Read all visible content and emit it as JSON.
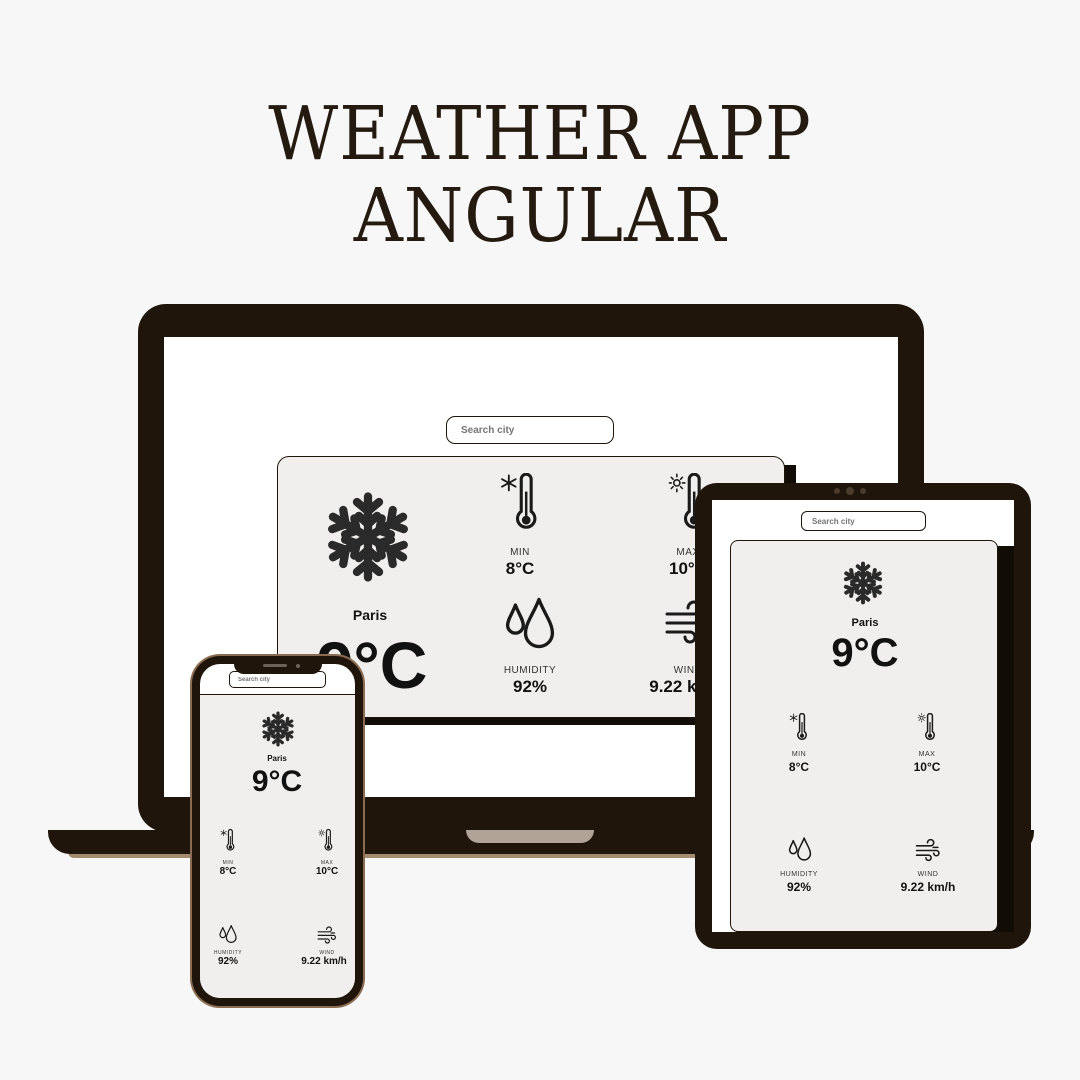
{
  "heading": {
    "line1": "WEATHER APP",
    "line2": "ANGULAR"
  },
  "colors": {
    "frame": "#1f150b",
    "card": "#f1efed",
    "accent": "#a68a6e"
  },
  "weather": {
    "search_placeholder": "Search city",
    "city": "Paris",
    "temp": "9°C",
    "min_label": "MIN",
    "min_value": "8°C",
    "max_label": "MAX",
    "max_value": "10°C",
    "humidity_label": "HUMIDITY",
    "humidity_value": "92%",
    "wind_label": "WIND",
    "wind_value": "9.22 km/h",
    "icons": [
      "snowflake-icon",
      "thermometer-snow-icon",
      "thermometer-sun-icon",
      "droplets-icon",
      "wind-icon"
    ]
  }
}
